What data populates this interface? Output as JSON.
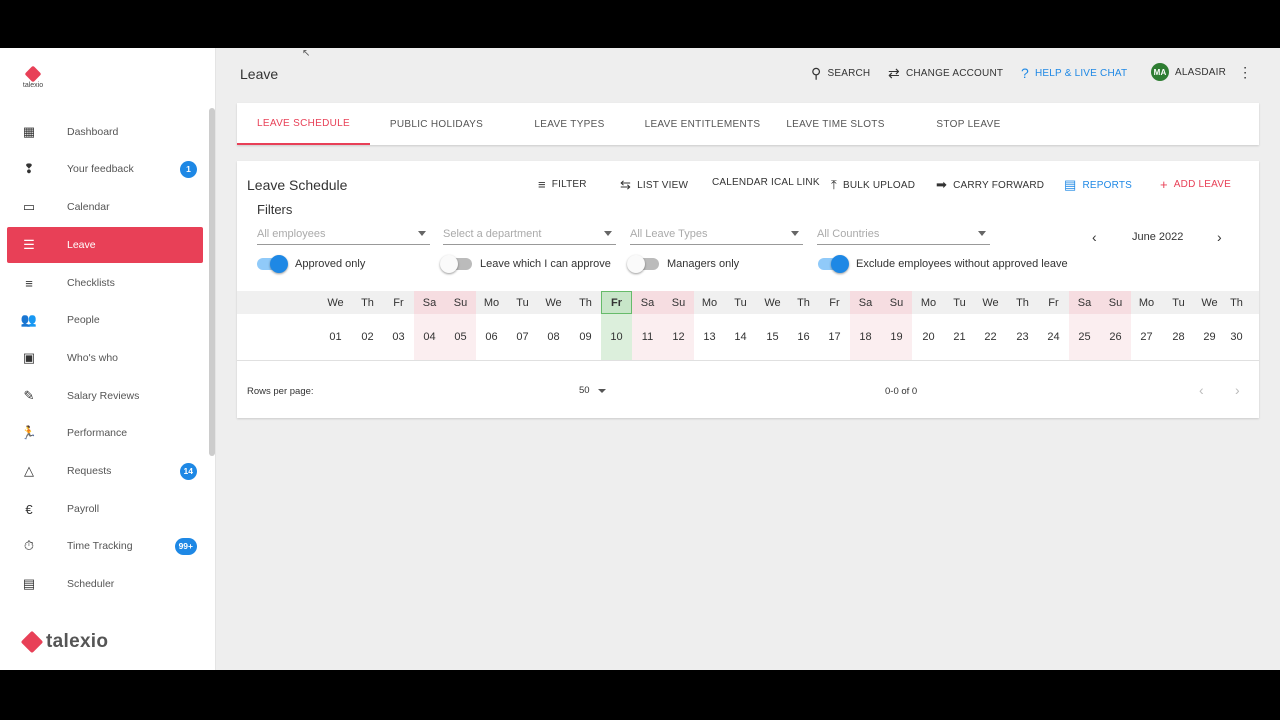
{
  "app": {
    "logo_small_text": "talexio",
    "logo_text": "talexio",
    "page_title": "Leave"
  },
  "header": {
    "search": "SEARCH",
    "change_account": "CHANGE ACCOUNT",
    "help": "HELP & LIVE CHAT",
    "avatar_initials": "MA",
    "user": "ALASDAIR"
  },
  "sidebar": {
    "items": [
      {
        "label": "Dashboard",
        "icon": "dashboard-icon",
        "glyph": "▦"
      },
      {
        "label": "Your feedback",
        "icon": "feedback-icon",
        "glyph": "❢",
        "badge": "1"
      },
      {
        "label": "Calendar",
        "icon": "calendar-icon",
        "glyph": "▭"
      },
      {
        "label": "Leave",
        "icon": "leave-icon",
        "glyph": "☰",
        "active": true
      },
      {
        "label": "Checklists",
        "icon": "checklist-icon",
        "glyph": "≡"
      },
      {
        "label": "People",
        "icon": "people-icon",
        "glyph": "👥"
      },
      {
        "label": "Who's who",
        "icon": "badge-icon",
        "glyph": "▣"
      },
      {
        "label": "Salary Reviews",
        "icon": "rate-review-icon",
        "glyph": "✎"
      },
      {
        "label": "Performance",
        "icon": "run-icon",
        "glyph": "🏃"
      },
      {
        "label": "Requests",
        "icon": "warning-icon",
        "glyph": "△",
        "badge": "14"
      },
      {
        "label": "Payroll",
        "icon": "euro-icon",
        "glyph": "€"
      },
      {
        "label": "Time Tracking",
        "icon": "timer-icon",
        "glyph": "⏱",
        "badge": "99+"
      },
      {
        "label": "Scheduler",
        "icon": "event-icon",
        "glyph": "▤"
      }
    ]
  },
  "tabs": [
    "LEAVE SCHEDULE",
    "PUBLIC HOLIDAYS",
    "LEAVE TYPES",
    "LEAVE ENTITLEMENTS",
    "LEAVE TIME SLOTS",
    "STOP LEAVE"
  ],
  "card": {
    "title": "Leave Schedule",
    "tools": {
      "filter": "FILTER",
      "list_view": "LIST VIEW",
      "ical": "CALENDAR ICAL LINK",
      "bulk": "BULK UPLOAD",
      "carry": "CARRY FORWARD",
      "reports": "REPORTS",
      "add": "ADD LEAVE"
    },
    "filters_label": "Filters",
    "selects": [
      "All employees",
      "Select a department",
      "All Leave Types",
      "All Countries"
    ],
    "month": "June 2022",
    "toggles": [
      {
        "label": "Approved only",
        "on": true
      },
      {
        "label": "Leave which I can approve",
        "on": false
      },
      {
        "label": "Managers only",
        "on": false
      },
      {
        "label": "Exclude employees without approved leave",
        "on": true
      }
    ]
  },
  "calendar": {
    "weekdays": [
      "We",
      "Th",
      "Fr",
      "Sa",
      "Su",
      "Mo",
      "Tu",
      "We",
      "Th",
      "Fr",
      "Sa",
      "Su",
      "Mo",
      "Tu",
      "We",
      "Th",
      "Fr",
      "Sa",
      "Su",
      "Mo",
      "Tu",
      "We",
      "Th",
      "Fr",
      "Sa",
      "Su",
      "Mo",
      "Tu",
      "We",
      "Th"
    ],
    "days": [
      "01",
      "02",
      "03",
      "04",
      "05",
      "06",
      "07",
      "08",
      "09",
      "10",
      "11",
      "12",
      "13",
      "14",
      "15",
      "16",
      "17",
      "18",
      "19",
      "20",
      "21",
      "22",
      "23",
      "24",
      "25",
      "26",
      "27",
      "28",
      "29",
      "30"
    ],
    "today": "10"
  },
  "footer": {
    "rows_per_page_label": "Rows per page:",
    "rows_per_page": "50",
    "range": "0-0 of 0"
  },
  "colors": {
    "accent": "#e84057",
    "blue": "#1e88e5"
  }
}
